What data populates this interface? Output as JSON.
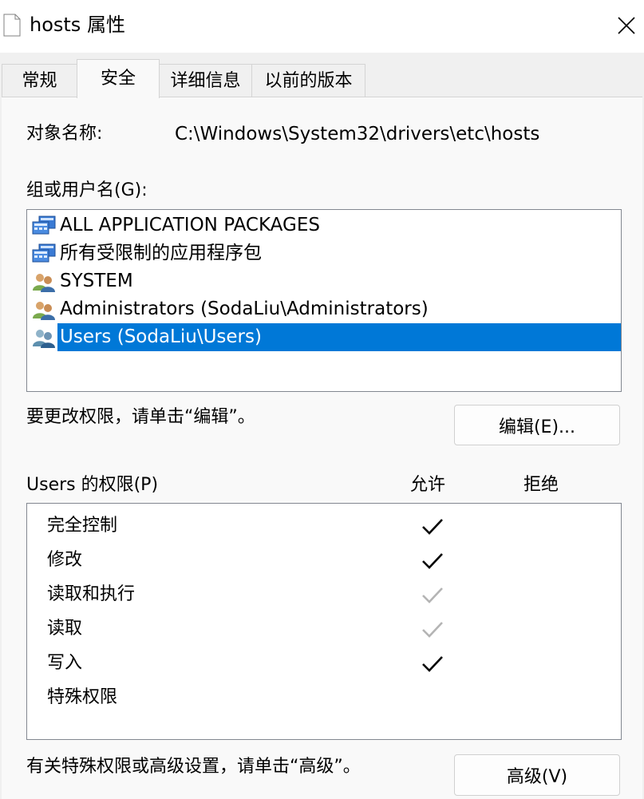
{
  "window": {
    "title": "hosts 属性",
    "close_icon": "close-icon",
    "file_icon": "document-icon"
  },
  "tabs": [
    {
      "label": "常规",
      "active": false
    },
    {
      "label": "安全",
      "active": true
    },
    {
      "label": "详细信息",
      "active": false
    },
    {
      "label": "以前的版本",
      "active": false
    }
  ],
  "object": {
    "label": "对象名称:",
    "value": "C:\\Windows\\System32\\drivers\\etc\\hosts"
  },
  "groups": {
    "label": "组或用户名(G):",
    "items": [
      {
        "name": "ALL APPLICATION PACKAGES",
        "icon": "app-packages-icon",
        "selected": false
      },
      {
        "name": "所有受限制的应用程序包",
        "icon": "app-packages-icon",
        "selected": false
      },
      {
        "name": "SYSTEM",
        "icon": "user-group-icon",
        "selected": false
      },
      {
        "name": "Administrators (SodaLiu\\Administrators)",
        "icon": "user-group-icon",
        "selected": false
      },
      {
        "name": "Users (SodaLiu\\Users)",
        "icon": "user-group-icon",
        "selected": true
      }
    ]
  },
  "edit": {
    "hint": "要更改权限，请单击“编辑”。",
    "button_label": "编辑(E)..."
  },
  "permissions": {
    "label": "Users 的权限(P)",
    "allow_header": "允许",
    "deny_header": "拒绝",
    "items": [
      {
        "name": "完全控制",
        "allow": "checked"
      },
      {
        "name": "修改",
        "allow": "checked"
      },
      {
        "name": "读取和执行",
        "allow": "inherited"
      },
      {
        "name": "读取",
        "allow": "inherited"
      },
      {
        "name": "写入",
        "allow": "checked"
      },
      {
        "name": "特殊权限",
        "allow": "none"
      }
    ]
  },
  "advanced": {
    "hint": "有关特殊权限或高级设置，请单击“高级”。",
    "button_label": "高级(V)"
  },
  "colors": {
    "selection": "#0078d7",
    "check": "#000000",
    "check_inherited": "#b4b4b4"
  }
}
